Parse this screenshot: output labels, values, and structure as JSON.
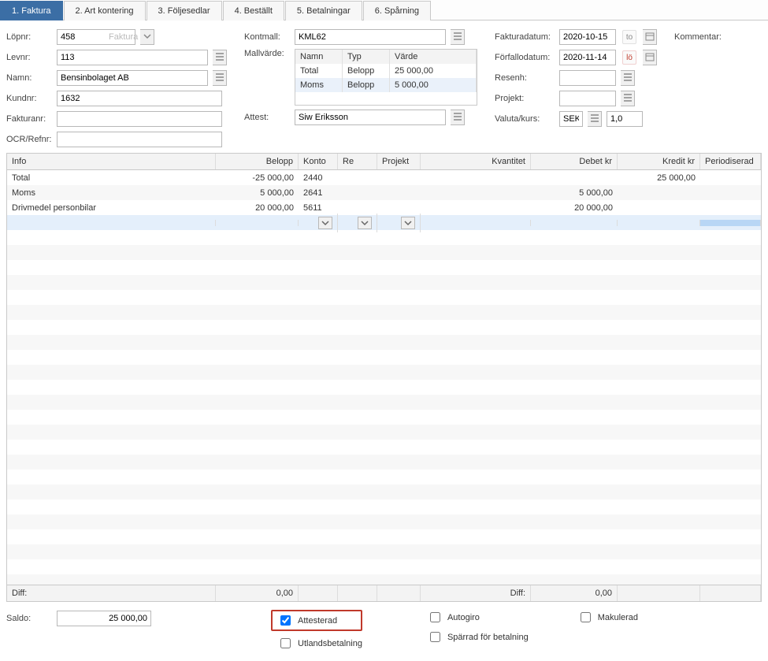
{
  "tabs": [
    "1. Faktura",
    "2. Art kontering",
    "3. Följesedlar",
    "4. Beställt",
    "5. Betalningar",
    "6. Spårning"
  ],
  "form": {
    "lopnr_label": "Löpnr:",
    "lopnr_value": "458",
    "lopnr_placeholder": "Faktura",
    "levnr_label": "Levnr:",
    "levnr_value": "113",
    "namn_label": "Namn:",
    "namn_value": "Bensinbolaget AB",
    "kundnr_label": "Kundnr:",
    "kundnr_value": "1632",
    "fakturanr_label": "Fakturanr:",
    "fakturanr_value": "",
    "ocr_label": "OCR/Refnr:",
    "ocr_value": "",
    "kontmall_label": "Kontmall:",
    "kontmall_value": "KML62",
    "mallvarde_label": "Mallvärde:",
    "attest_label": "Attest:",
    "attest_value": "Siw Eriksson",
    "fakturadatum_label": "Fakturadatum:",
    "fakturadatum_value": "2020-10-15",
    "fakturadatum_day": "to",
    "forfallodatum_label": "Förfallodatum:",
    "forfallodatum_value": "2020-11-14",
    "forfallodatum_day": "lö",
    "resenh_label": "Resenh:",
    "resenh_value": "",
    "projekt_label": "Projekt:",
    "projekt_value": "",
    "valutakurs_label": "Valuta/kurs:",
    "valuta_value": "SEK",
    "kurs_value": "1,0",
    "kommentar_label": "Kommentar:"
  },
  "mallvarde": {
    "headers": [
      "Namn",
      "Typ",
      "Värde"
    ],
    "rows": [
      {
        "namn": "Total",
        "typ": "Belopp",
        "varde": "25 000,00"
      },
      {
        "namn": "Moms",
        "typ": "Belopp",
        "varde": "5 000,00"
      }
    ]
  },
  "grid": {
    "headers": {
      "info": "Info",
      "belopp": "Belopp",
      "konto": "Konto",
      "re": "Re",
      "projekt": "Projekt",
      "kvantitet": "Kvantitet",
      "debet": "Debet kr",
      "kredit": "Kredit kr",
      "periodiserad": "Periodiserad"
    },
    "rows": [
      {
        "info": "Total",
        "belopp": "-25 000,00",
        "konto": "2440",
        "re": "",
        "projekt": "",
        "kvantitet": "",
        "debet": "",
        "kredit": "25 000,00"
      },
      {
        "info": "Moms",
        "belopp": "5 000,00",
        "konto": "2641",
        "re": "",
        "projekt": "",
        "kvantitet": "",
        "debet": "5 000,00",
        "kredit": ""
      },
      {
        "info": "Drivmedel personbilar",
        "belopp": "20 000,00",
        "konto": "5611",
        "re": "",
        "projekt": "",
        "kvantitet": "",
        "debet": "20 000,00",
        "kredit": ""
      }
    ],
    "footer": {
      "diff_label": "Diff:",
      "diff_left": "0,00",
      "diff_right_label": "Diff:",
      "diff_right": "0,00"
    }
  },
  "bottom": {
    "saldo_label": "Saldo:",
    "saldo_value": "25 000,00",
    "attesterad_label": "Attesterad",
    "attesterad_checked": true,
    "utlandsbetalning_label": "Utlandsbetalning",
    "utlandsbetalning_checked": false,
    "autogiro_label": "Autogiro",
    "autogiro_checked": false,
    "sparrad_label": "Spärrad för betalning",
    "sparrad_checked": false,
    "makulerad_label": "Makulerad",
    "makulerad_checked": false
  }
}
